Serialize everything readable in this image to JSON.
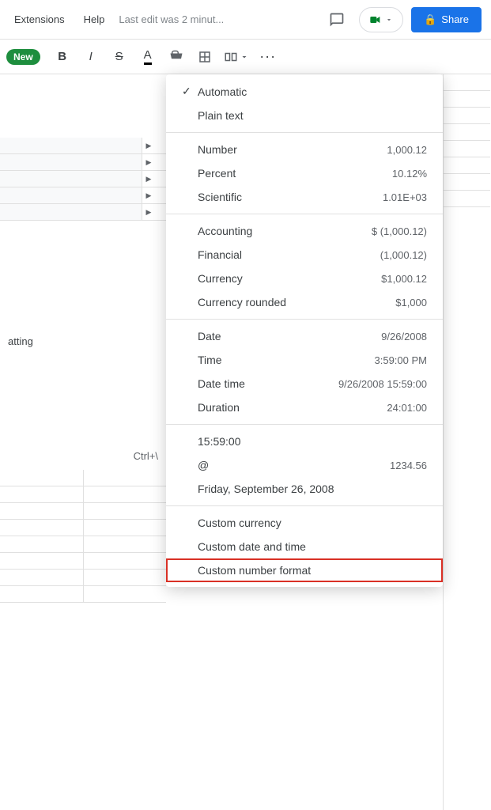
{
  "topbar": {
    "menu_items": [
      "Extensions",
      "Help"
    ],
    "last_edit": "Last edit was 2 minut...",
    "share_label": "Share",
    "lock_icon": "🔒"
  },
  "toolbar": {
    "new_badge": "New",
    "buttons": [
      {
        "id": "bold",
        "label": "B",
        "style": "bold"
      },
      {
        "id": "italic",
        "label": "I",
        "style": "italic"
      },
      {
        "id": "strikethrough",
        "label": "S",
        "style": "strikethrough"
      },
      {
        "id": "underline",
        "label": "A",
        "style": "underline"
      },
      {
        "id": "paint",
        "label": "🪣",
        "style": "normal"
      },
      {
        "id": "border",
        "label": "⊞",
        "style": "normal"
      },
      {
        "id": "merge",
        "label": "⊡",
        "style": "normal"
      },
      {
        "id": "more",
        "label": "···",
        "style": "normal"
      }
    ]
  },
  "left_panel": {
    "formatting_label": "atting",
    "shortcut": "Ctrl+\\"
  },
  "dropdown": {
    "items": [
      {
        "id": "automatic",
        "label": "Automatic",
        "value": "",
        "checked": true,
        "separator_after": false
      },
      {
        "id": "plain-text",
        "label": "Plain text",
        "value": "",
        "checked": false,
        "separator_after": true
      },
      {
        "id": "number",
        "label": "Number",
        "value": "1,000.12",
        "checked": false,
        "separator_after": false
      },
      {
        "id": "percent",
        "label": "Percent",
        "value": "10.12%",
        "checked": false,
        "separator_after": false
      },
      {
        "id": "scientific",
        "label": "Scientific",
        "value": "1.01E+03",
        "checked": false,
        "separator_after": true
      },
      {
        "id": "accounting",
        "label": "Accounting",
        "value": "$ (1,000.12)",
        "checked": false,
        "separator_after": false
      },
      {
        "id": "financial",
        "label": "Financial",
        "value": "(1,000.12)",
        "checked": false,
        "separator_after": false
      },
      {
        "id": "currency",
        "label": "Currency",
        "value": "$1,000.12",
        "checked": false,
        "separator_after": false
      },
      {
        "id": "currency-rounded",
        "label": "Currency rounded",
        "value": "$1,000",
        "checked": false,
        "separator_after": true
      },
      {
        "id": "date",
        "label": "Date",
        "value": "9/26/2008",
        "checked": false,
        "separator_after": false
      },
      {
        "id": "time",
        "label": "Time",
        "value": "3:59:00 PM",
        "checked": false,
        "separator_after": false
      },
      {
        "id": "date-time",
        "label": "Date time",
        "value": "9/26/2008 15:59:00",
        "checked": false,
        "separator_after": false
      },
      {
        "id": "duration",
        "label": "Duration",
        "value": "24:01:00",
        "checked": false,
        "separator_after": true
      },
      {
        "id": "time-format",
        "label": "15:59:00",
        "value": "",
        "checked": false,
        "separator_after": false
      },
      {
        "id": "at-format",
        "label": "@",
        "value": "1234.56",
        "checked": false,
        "separator_after": false
      },
      {
        "id": "date-long",
        "label": "Friday, September 26, 2008",
        "value": "",
        "checked": false,
        "separator_after": true
      },
      {
        "id": "custom-currency",
        "label": "Custom currency",
        "value": "",
        "checked": false,
        "separator_after": false
      },
      {
        "id": "custom-date-time",
        "label": "Custom date and time",
        "value": "",
        "checked": false,
        "separator_after": false
      },
      {
        "id": "custom-number",
        "label": "Custom number format",
        "value": "",
        "checked": false,
        "highlighted": true,
        "separator_after": false
      }
    ]
  }
}
